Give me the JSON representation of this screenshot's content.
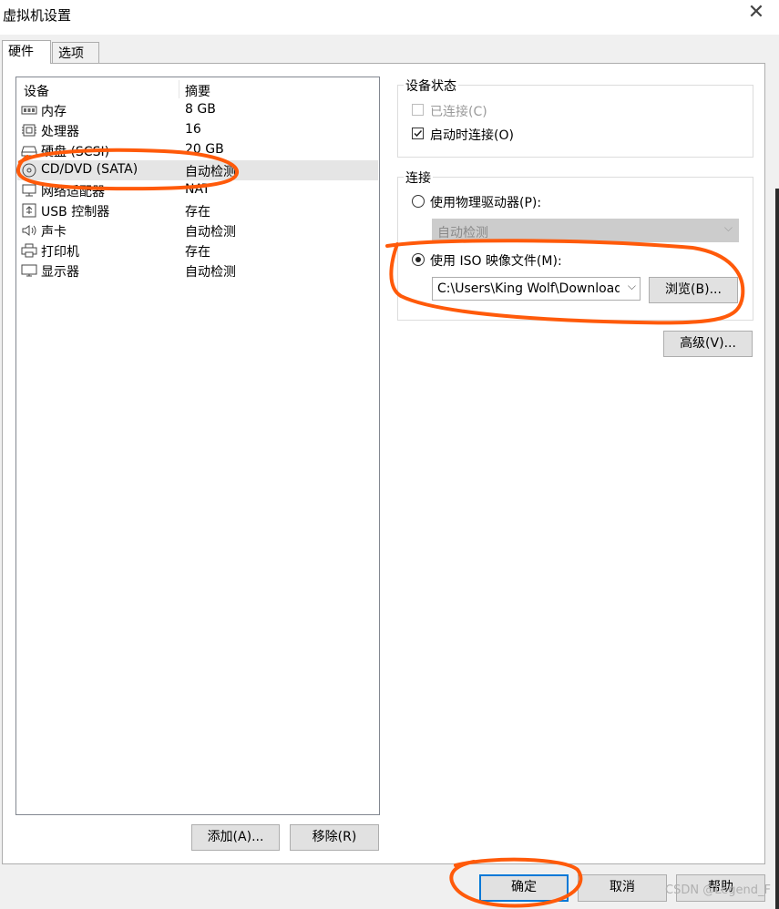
{
  "window": {
    "title": "虚拟机设置"
  },
  "tabs": [
    {
      "label": "硬件",
      "active": true
    },
    {
      "label": "选项",
      "active": false
    }
  ],
  "device_list": {
    "headers": {
      "device": "设备",
      "summary": "摘要"
    },
    "rows": [
      {
        "icon": "memory-icon",
        "name": "内存",
        "summary": "8 GB"
      },
      {
        "icon": "processor-icon",
        "name": "处理器",
        "summary": "16"
      },
      {
        "icon": "hard-disk-icon",
        "name": "硬盘 (SCSI)",
        "summary": "20 GB"
      },
      {
        "icon": "cd-dvd-icon",
        "name": "CD/DVD (SATA)",
        "summary": "自动检测",
        "selected": true
      },
      {
        "icon": "network-adapter-icon",
        "name": "网络适配器",
        "summary": "NAT"
      },
      {
        "icon": "usb-icon",
        "name": "USB 控制器",
        "summary": "存在"
      },
      {
        "icon": "sound-card-icon",
        "name": "声卡",
        "summary": "自动检测"
      },
      {
        "icon": "printer-icon",
        "name": "打印机",
        "summary": "存在"
      },
      {
        "icon": "display-icon",
        "name": "显示器",
        "summary": "自动检测"
      }
    ]
  },
  "list_buttons": {
    "add": "添加(A)...",
    "remove": "移除(R)"
  },
  "device_status": {
    "title": "设备状态",
    "connected": {
      "label": "已连接(C)",
      "checked": false,
      "enabled": false
    },
    "connect_at_power_on": {
      "label": "启动时连接(O)",
      "checked": true,
      "enabled": true
    }
  },
  "connection": {
    "title": "连接",
    "physical_drive": {
      "label": "使用物理驱动器(P):",
      "selected": false,
      "value": "自动检测"
    },
    "iso_image": {
      "label": "使用 ISO 映像文件(M):",
      "selected": true,
      "value": "C:\\Users\\King Wolf\\Downloads"
    },
    "browse_label": "浏览(B)..."
  },
  "advanced_label": "高级(V)...",
  "footer": {
    "ok": "确定",
    "cancel": "取消",
    "help": "帮助"
  },
  "watermark": "CSDN @Legend_F",
  "colors": {
    "annotation": "#ff5a0a",
    "selection": "#e5e5e5",
    "default_button_border": "#0078d7"
  }
}
